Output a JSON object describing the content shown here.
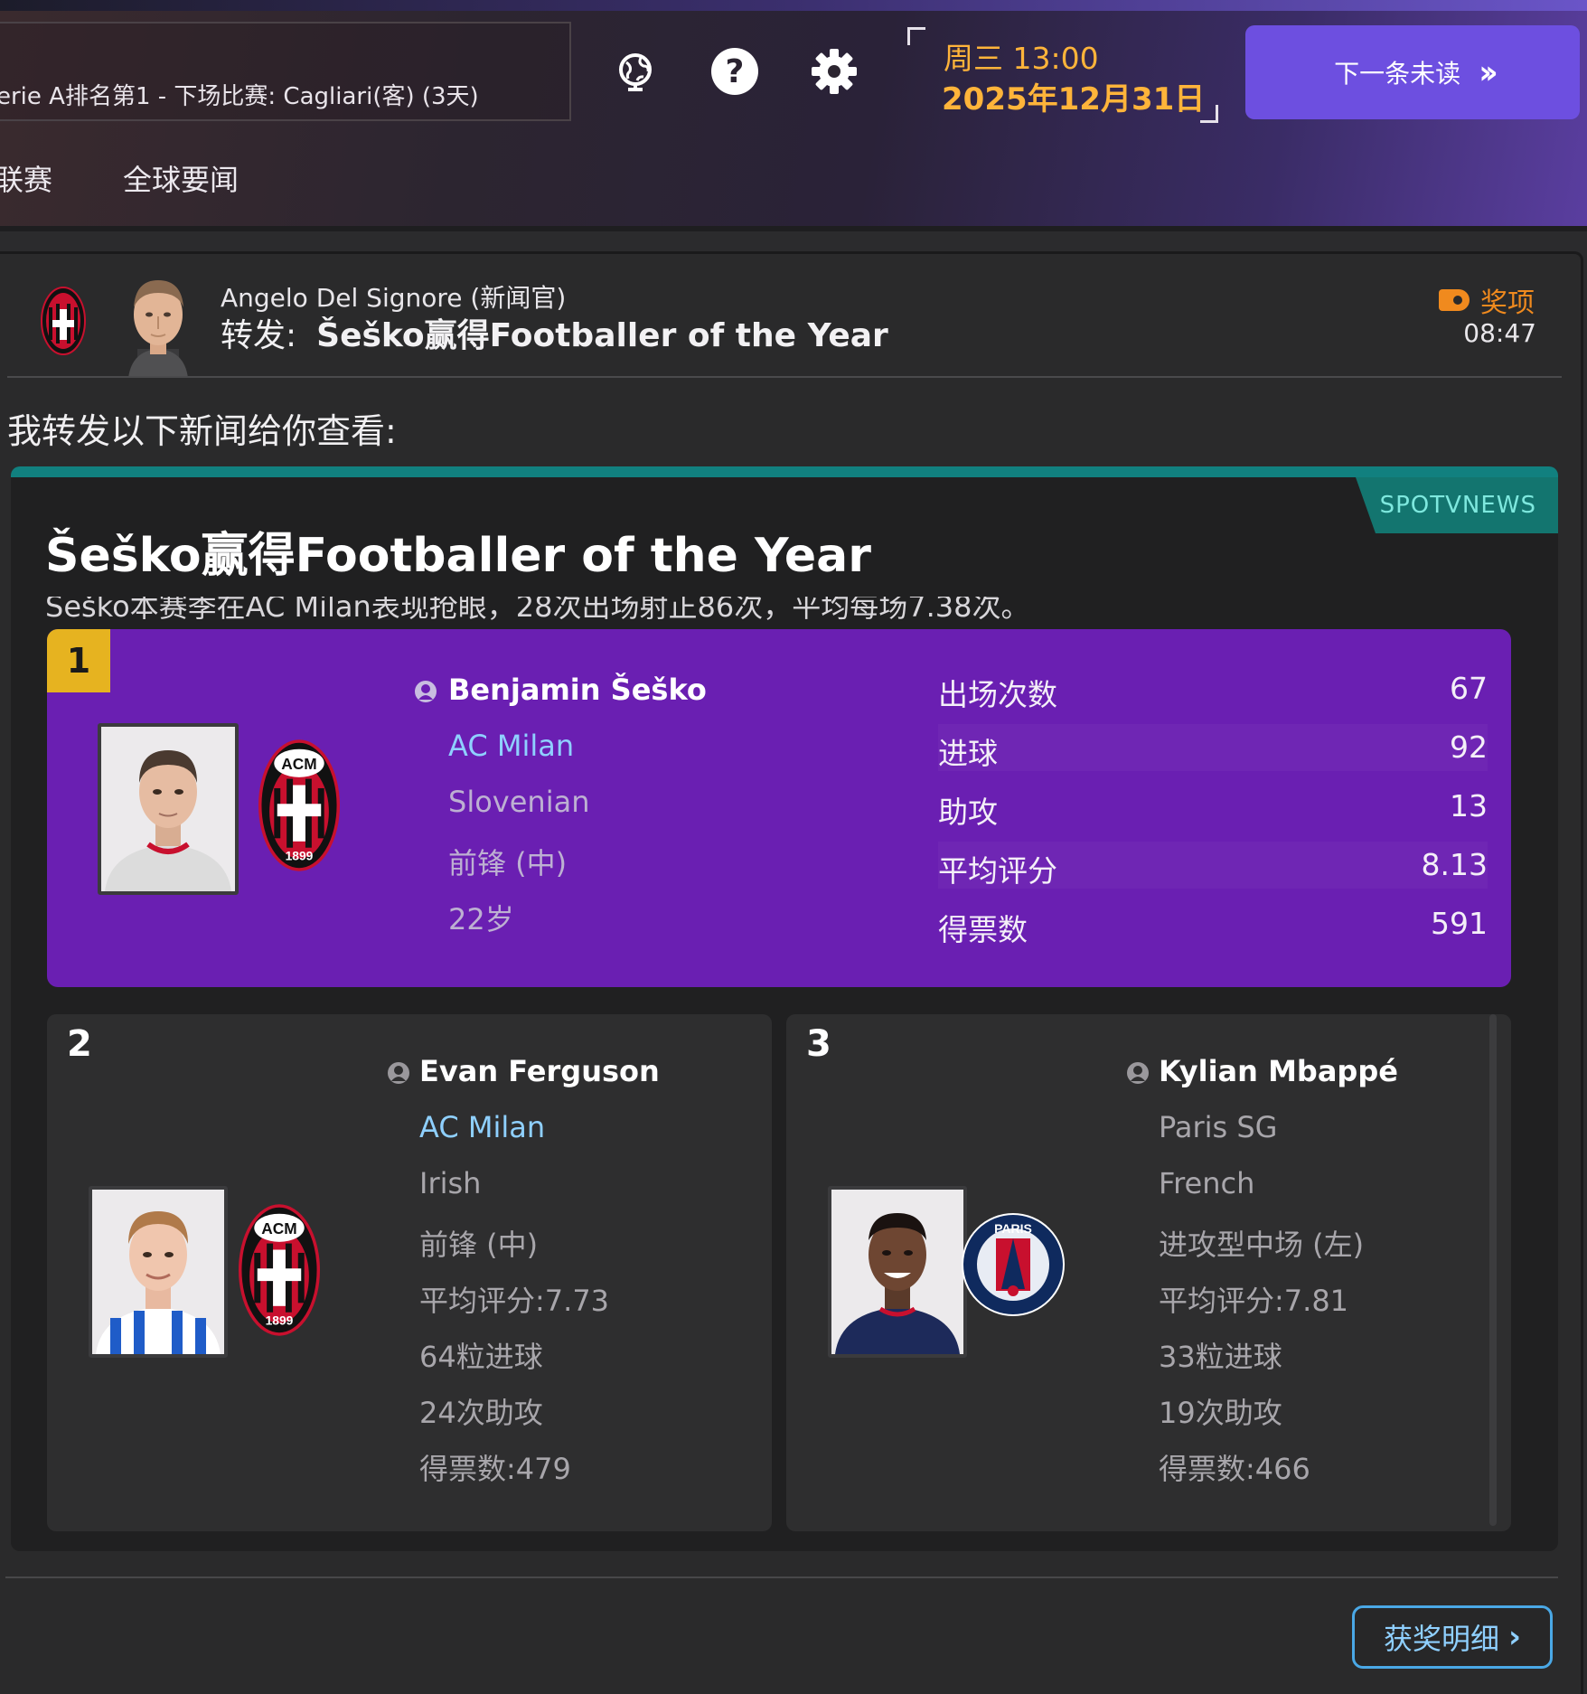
{
  "header": {
    "league_status": "erie A排名第1 - 下场比赛: Cagliari(客) (3天)",
    "day_time": "周三 13:00",
    "date": "2025年12月31日",
    "next_unread": "下一条未读",
    "tabs": [
      "联赛",
      "全球要闻"
    ],
    "icons": [
      "globe-icon",
      "help-icon",
      "settings-gear-icon",
      "double-chevron-icon"
    ]
  },
  "message": {
    "sender": "Angelo Del Signore (新闻官)",
    "subject_prefix": "转发:",
    "subject": "Šeško赢得Footballer of the Year",
    "tag": "奖项",
    "time": "08:47",
    "intro": "我转发以下新闻给你查看:"
  },
  "news": {
    "source": "SPOTVNEWS",
    "title": "Šeško赢得Footballer of the Year",
    "body": "Šeško本赛季在AC Milan表现抢眼，28次出场射正86次，平均每场7.38次。"
  },
  "winner": {
    "rank": "1",
    "name": "Benjamin Šeško",
    "club": "AC Milan",
    "nationality": "Slovenian",
    "position": "前锋 (中)",
    "age": "22岁",
    "stats": [
      {
        "label": "出场次数",
        "value": "67"
      },
      {
        "label": "进球",
        "value": "92"
      },
      {
        "label": "助攻",
        "value": "13"
      },
      {
        "label": "平均评分",
        "value": "8.13"
      },
      {
        "label": "得票数",
        "value": "591"
      }
    ]
  },
  "runners_up": [
    {
      "rank": "2",
      "name": "Evan Ferguson",
      "club": "AC Milan",
      "nationality": "Irish",
      "position": "前锋 (中)",
      "rating": "平均评分:7.73",
      "goals": "64粒进球",
      "assists": "24次助攻",
      "votes": "得票数:479"
    },
    {
      "rank": "3",
      "name": "Kylian Mbappé",
      "club": "Paris SG",
      "nationality": "French",
      "position": "进攻型中场 (左)",
      "rating": "平均评分:7.81",
      "goals": "33粒进球",
      "assists": "19次助攻",
      "votes": "得票数:466"
    }
  ],
  "footer": {
    "awards_button": "获奖明细"
  },
  "colors": {
    "accent_purple": "#6d4fe0",
    "winner_bg": "#6a1fb2",
    "date_orange": "#ffb43a",
    "tag_orange": "#f08a1e",
    "club_link": "#8fd0ff",
    "news_teal": "#11807f"
  }
}
